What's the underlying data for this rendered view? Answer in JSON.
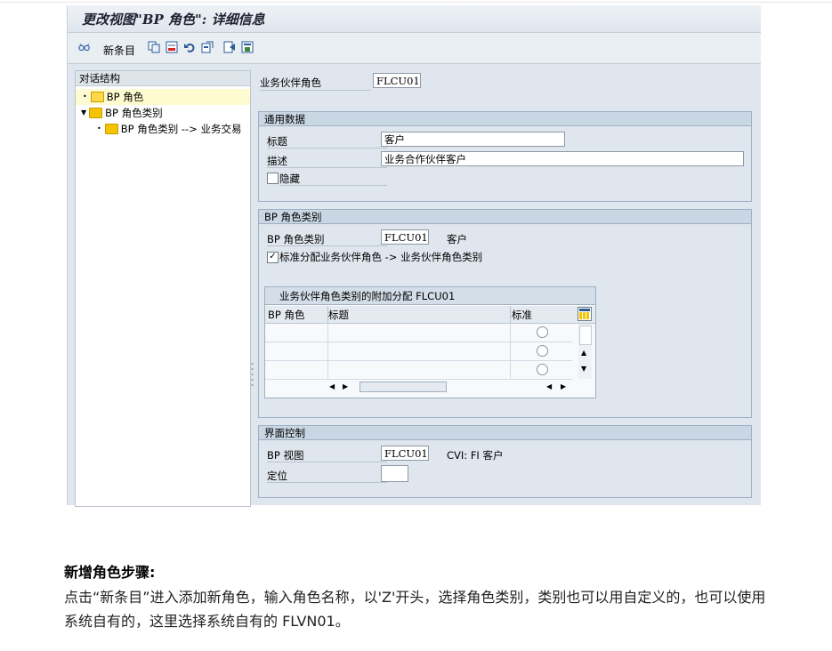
{
  "window": {
    "title": "更改视图\"BP 角色\": 详细信息",
    "toolbar": {
      "new_entry_label": "新条目",
      "icons": [
        "glasses-icon",
        "copy-icon",
        "delete-icon",
        "undo-icon",
        "select-all-icon",
        "prev-entry-icon",
        "next-entry-icon",
        "transport-icon"
      ]
    }
  },
  "dialog_structure": {
    "header": "对话结构",
    "items": [
      {
        "label": "BP 角色",
        "selected": true
      },
      {
        "label": "BP 角色类别",
        "expanded": true
      },
      {
        "label": "BP 角色类别 --> 业务交易"
      }
    ]
  },
  "bp_role": {
    "label": "业务伙伴角色",
    "value": "FLCU01"
  },
  "general": {
    "header": "通用数据",
    "title_label": "标题",
    "title_value": "客户",
    "desc_label": "描述",
    "desc_value": "业务合作伙伴客户",
    "hidden_label": "隐藏",
    "hidden_checked": false
  },
  "category": {
    "header": "BP 角色类别",
    "label": "BP 角色类别",
    "value": "FLCU01",
    "value_text": "客户",
    "std_assign_label": "标准分配业务伙伴角色 -> 业务伙伴角色类别",
    "std_assign_checked": true,
    "table": {
      "title": "业务伙伴角色类别的附加分配 FLCU01",
      "columns": [
        "BP 角色",
        "标题",
        "标准"
      ],
      "rows": [
        {
          "role": "",
          "title": ""
        },
        {
          "role": "",
          "title": ""
        },
        {
          "role": "",
          "title": ""
        }
      ]
    }
  },
  "ui_control": {
    "header": "界面控制",
    "bp_view_label": "BP 视图",
    "bp_view_value": "FLCU01",
    "bp_view_text": "CVI: FI 客户",
    "position_label": "定位",
    "position_value": ""
  },
  "note": {
    "heading": "新增角色步骤:",
    "body": "点击“新条目”进入添加新角色，输入角色名称，以'Z'开头，选择角色类别，类别也可以用自定义的，也可以使用系统自有的，这里选择系统自有的 FLVN01。"
  },
  "colors": {
    "sap_bg": "#dfe6ee",
    "group_head": "#c9d6e3",
    "selected_row": "#fffbd0",
    "folder": "#f5c400"
  }
}
